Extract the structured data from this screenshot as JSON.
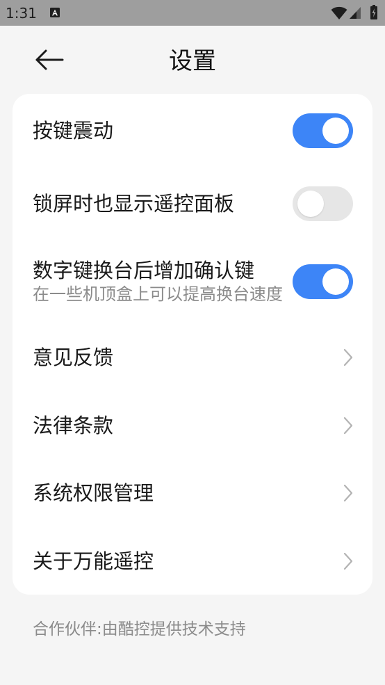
{
  "status_bar": {
    "time": "1:31",
    "icons": [
      "a-notification-icon",
      "wifi-icon",
      "signal-icon",
      "battery-icon"
    ]
  },
  "header": {
    "back_icon": "back-arrow-icon",
    "title": "设置"
  },
  "settings": {
    "items": [
      {
        "label": "按键震动",
        "toggle_on": true
      },
      {
        "label": "锁屏时也显示遥控面板",
        "toggle_on": false
      },
      {
        "label": "数字键换台后增加确认键",
        "sublabel": "在一些机顶盒上可以提高换台速度",
        "toggle_on": true
      },
      {
        "label": "意见反馈",
        "icon": "chevron-right-icon"
      },
      {
        "label": "法律条款",
        "icon": "chevron-right-icon"
      },
      {
        "label": "系统权限管理",
        "icon": "chevron-right-icon"
      },
      {
        "label": "关于万能遥控",
        "icon": "chevron-right-icon"
      }
    ]
  },
  "footer": {
    "text": "合作伙伴:由酷控提供技术支持"
  },
  "colors": {
    "status_bar": "#9e9e9e",
    "page_background": "#f5f5f5",
    "card_background": "#ffffff",
    "toggle_on": "#3d85f7",
    "toggle_off": "#e6e6e6",
    "secondary_text": "#8b8b8b"
  }
}
